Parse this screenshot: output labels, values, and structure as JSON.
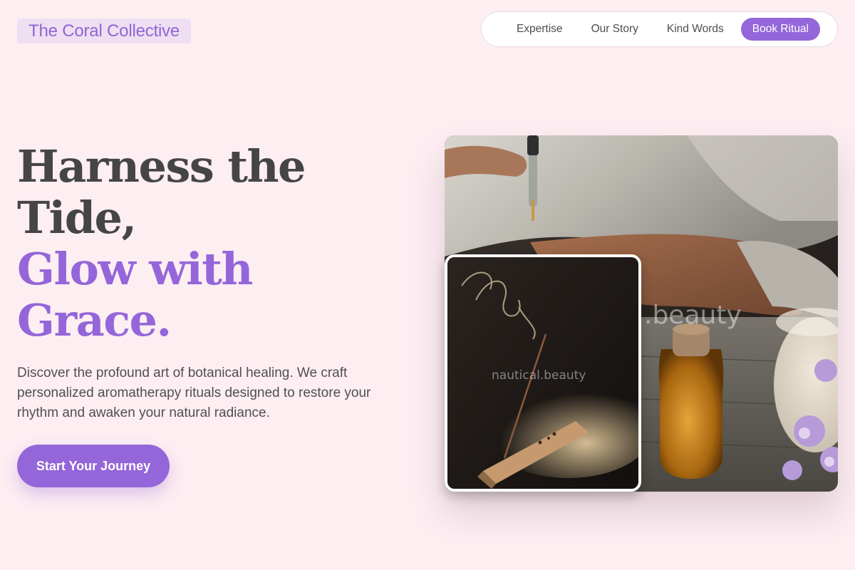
{
  "brand": {
    "logo_text": "The Coral Collective"
  },
  "nav": {
    "items": [
      {
        "label": "Expertise"
      },
      {
        "label": "Our Story"
      },
      {
        "label": "Kind Words"
      }
    ],
    "cta_label": "Book Ritual"
  },
  "hero": {
    "title_lines": [
      "Harness the",
      "Tide,"
    ],
    "title_accent_lines": [
      "Glow with",
      "Grace."
    ],
    "description": "Discover the profound art of botanical healing. We craft personalized aromatherapy rituals designed to restore your rhythm and awaken your natural radiance.",
    "cta_label": "Start Your Journey"
  },
  "media": {
    "main_image_watermark": ".beauty",
    "inset_image_watermark": "nautical.beauty"
  },
  "colors": {
    "background": "#fdeef2",
    "accent": "#9466d9",
    "logo_background": "#efdff2",
    "heading_text": "#454545"
  },
  "icons": [
    "dropper-photo",
    "incense-photo"
  ]
}
